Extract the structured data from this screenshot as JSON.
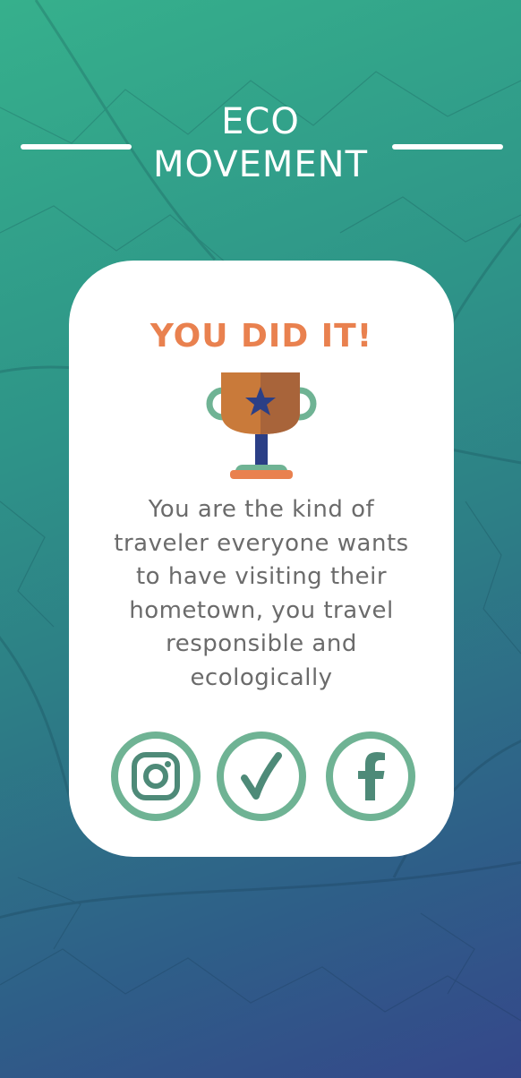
{
  "app": {
    "title_line1": "ECO",
    "title_line2": "MOVEMENT"
  },
  "result": {
    "headline": "YOU DID IT!",
    "message": "You are the kind of traveler everyone wants to have visiting their hometown, you travel responsible and ecologically"
  },
  "icons": {
    "trophy": "trophy-icon",
    "social": [
      "instagram-icon",
      "checkmark-icon",
      "facebook-icon"
    ]
  },
  "colors": {
    "accent": "#e9814f",
    "icon_green": "#6fb394",
    "icon_dark_green": "#4e8a78",
    "text_gray": "#6b6b6b",
    "trophy_navy": "#2b3f86"
  }
}
